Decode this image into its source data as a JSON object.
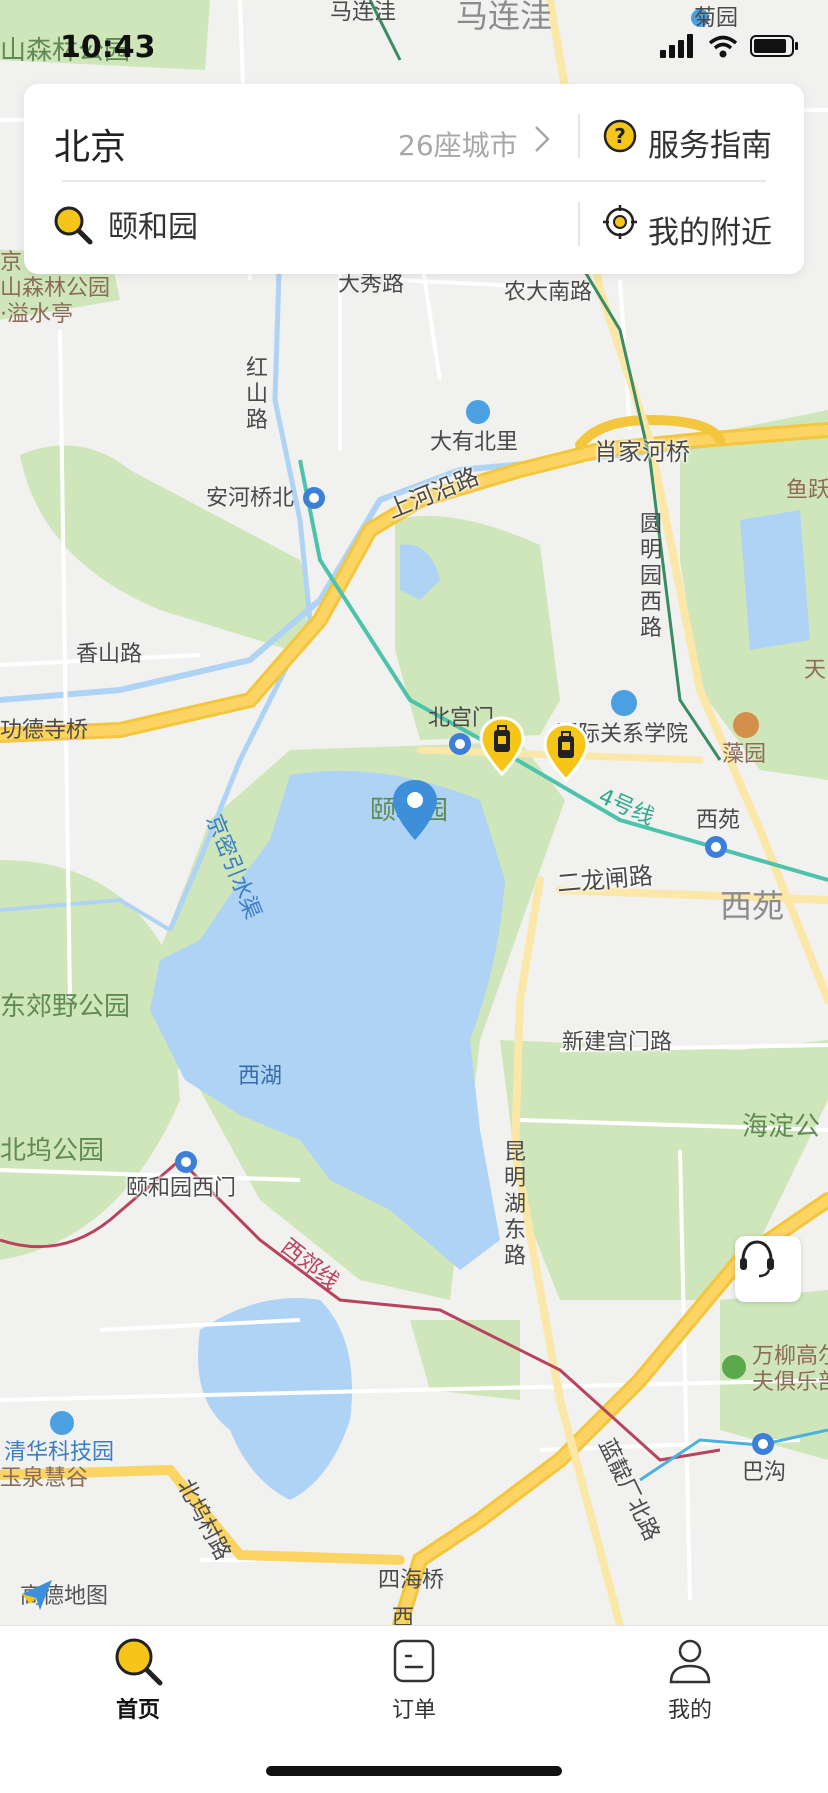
{
  "status_bar": {
    "time": "10:43"
  },
  "search_card": {
    "city": "北京",
    "city_count": "26座城市",
    "guide_label": "服务指南",
    "search_value": "颐和园",
    "nearby_label": "我的附近"
  },
  "map": {
    "labels": {
      "malianwa_road": "马连洼",
      "malianwa_area": "马连洼",
      "juyuan": "菊园",
      "forest_park_top": "山森林公园",
      "daxiu_road": "大秀路",
      "nongda_south": "农大南路",
      "forest_park_left1": "京",
      "forest_park_left2": "山森林公园",
      "yishui_pavilion": "·溢水亭",
      "hongshan_road": "红山路",
      "dayou_beili": "大有北里",
      "xiaojiahe_bridge": "肖家河桥",
      "yuyue": "鱼跃",
      "anheqiao_north": "安河桥北",
      "shanghe_yanlu": "上河沿路",
      "yuanmingyuan_west": "圆明园西路",
      "tian": "天",
      "xiangshan_road": "香山路",
      "dezhou_bridge": "功德寺桥",
      "beigongmen": "北宫门",
      "intl_relations": "国际关系学院",
      "zaoyuan": "藻园",
      "yiheyuan_poi": "颐和园",
      "line4": "4号线",
      "xiyuan_station": "西苑",
      "jingmi_canal": "京密引水渠",
      "erlongzha_road": "二龙闸路",
      "xiyuan_area": "西苑",
      "dongjiaoye_park": "东郊野公园",
      "xinjian_gongmen": "新建宫门路",
      "xihu": "西湖",
      "haidian_park": "海淀公",
      "beiwu_park": "北坞公园",
      "yiheyuan_west_gate": "颐和园西门",
      "kunminghu_east": "昆明湖东路",
      "xijiao_line": "西郊线",
      "wanliu_club1": "万柳高尔",
      "wanliu_club2": "夫俱乐部",
      "tsinghua_park": "清华科技园",
      "yuquan_huigu": "玉泉慧谷",
      "lanjian_north": "蓝靛厂北路",
      "bagou": "巴沟",
      "beiwucun_road": "北坞村路",
      "sihai_bridge": "四海桥",
      "xi_bottom": "西"
    },
    "logo_text": "高德地图"
  },
  "tabs": [
    {
      "label": "首页",
      "active": true
    },
    {
      "label": "订单",
      "active": false
    },
    {
      "label": "我的",
      "active": false
    }
  ],
  "colors": {
    "accent_yellow": "#f5c518",
    "pin_blue": "#3d8fd9",
    "water": "#aed3f5",
    "park_green": "#cde8b4"
  }
}
